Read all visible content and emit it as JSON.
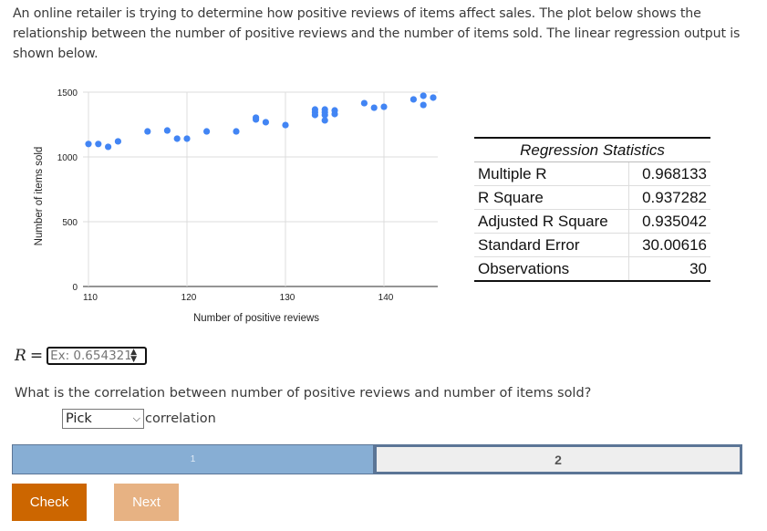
{
  "intro": "An online retailer is trying to determine how positive reviews of items affect sales. The plot below shows the relationship between the number of positive reviews and the number of items sold. The linear regression output is shown below.",
  "chart_data": {
    "type": "scatter",
    "title": "",
    "xlabel": "Number of positive reviews",
    "ylabel": "Number of items sold",
    "xlim": [
      110,
      145
    ],
    "ylim": [
      0,
      1500
    ],
    "xticks": [
      110,
      120,
      130,
      140
    ],
    "yticks": [
      0,
      500,
      1000,
      1500
    ],
    "grid": true,
    "color": "#4285f4",
    "points": [
      {
        "x": 110,
        "y": 1100
      },
      {
        "x": 111,
        "y": 1100
      },
      {
        "x": 112,
        "y": 1078
      },
      {
        "x": 113,
        "y": 1120
      },
      {
        "x": 116,
        "y": 1197
      },
      {
        "x": 118,
        "y": 1204
      },
      {
        "x": 119,
        "y": 1141
      },
      {
        "x": 120,
        "y": 1141
      },
      {
        "x": 122,
        "y": 1197
      },
      {
        "x": 125,
        "y": 1197
      },
      {
        "x": 127,
        "y": 1303
      },
      {
        "x": 127,
        "y": 1289
      },
      {
        "x": 128,
        "y": 1268
      },
      {
        "x": 130,
        "y": 1246
      },
      {
        "x": 133,
        "y": 1366
      },
      {
        "x": 133,
        "y": 1324
      },
      {
        "x": 133,
        "y": 1345
      },
      {
        "x": 134,
        "y": 1366
      },
      {
        "x": 134,
        "y": 1324
      },
      {
        "x": 134,
        "y": 1282
      },
      {
        "x": 134,
        "y": 1345
      },
      {
        "x": 135,
        "y": 1359
      },
      {
        "x": 135,
        "y": 1331
      },
      {
        "x": 138,
        "y": 1415
      },
      {
        "x": 139,
        "y": 1380
      },
      {
        "x": 140,
        "y": 1387
      },
      {
        "x": 143,
        "y": 1444
      },
      {
        "x": 144,
        "y": 1472
      },
      {
        "x": 144,
        "y": 1401
      },
      {
        "x": 145,
        "y": 1458
      }
    ]
  },
  "regression": {
    "title": "Regression Statistics",
    "rows": [
      {
        "label": "Multiple R",
        "value": "0.968133"
      },
      {
        "label": "R Square",
        "value": "0.937282"
      },
      {
        "label": "Adjusted R Square",
        "value": "0.935042"
      },
      {
        "label": "Standard Error",
        "value": "30.00616"
      },
      {
        "label": "Observations",
        "value": "30"
      }
    ]
  },
  "r_input": {
    "label": "R",
    "eq": "=",
    "placeholder": "Ex: 0.654321",
    "value": ""
  },
  "question": "What is the correlation between number of positive reviews and number of items sold?",
  "pick": {
    "selected": "Pick",
    "suffix": "correlation"
  },
  "progress": {
    "segments": [
      {
        "label": "1",
        "state": "done"
      },
      {
        "label": "2",
        "state": "current"
      }
    ]
  },
  "buttons": {
    "check": "Check",
    "next": "Next"
  }
}
